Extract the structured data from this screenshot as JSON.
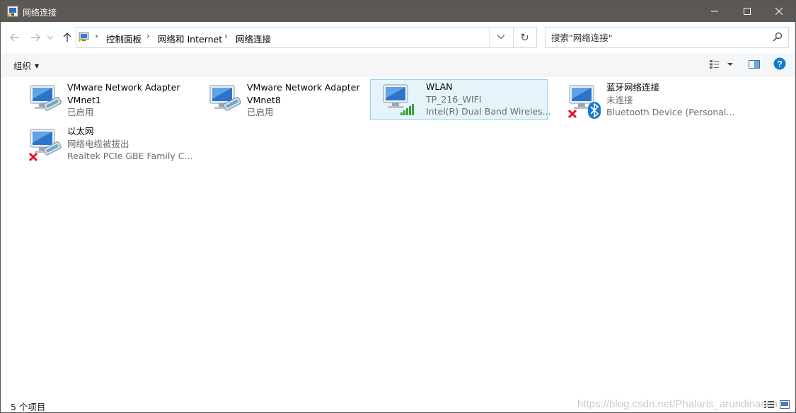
{
  "window": {
    "title": "网络连接",
    "icon": "network-connections-icon"
  },
  "addressbar": {
    "breadcrumbs": [
      "控制面板",
      "网络和 Internet",
      "网络连接"
    ],
    "refresh_glyph": "↻"
  },
  "search": {
    "placeholder": "搜索\"网络连接\""
  },
  "commandbar": {
    "organize_label": "组织"
  },
  "colors": {
    "titlebar": "#5d5854",
    "selection_bg": "#e5f3fb",
    "selection_border": "#99d1ef",
    "help_blue": "#1979ca",
    "error_red": "#e81123",
    "signal_green": "#3aa13a"
  },
  "items": [
    {
      "name": "VMware Network Adapter",
      "line2": "VMnet1",
      "line3": "已启用",
      "line2_style": "name",
      "icon": "network-adapter-icon",
      "status": "enabled"
    },
    {
      "name": "VMware Network Adapter",
      "line2": "VMnet8",
      "line3": "已启用",
      "line2_style": "name",
      "icon": "network-adapter-icon",
      "status": "enabled"
    },
    {
      "name": "WLAN",
      "line2": "TP_216_WIFI",
      "line3": "Intel(R) Dual Band Wireles...",
      "icon": "wifi-adapter-icon",
      "status": "connected",
      "selected": true
    },
    {
      "name": "蓝牙网络连接",
      "line2": "未连接",
      "line3": "Bluetooth Device (Personal...",
      "icon": "bluetooth-adapter-icon",
      "status": "disconnected"
    },
    {
      "name": "以太网",
      "line2": "网络电缆被拔出",
      "line3": "Realtek PCIe GBE Family C...",
      "icon": "ethernet-adapter-icon",
      "status": "cable-unplugged"
    }
  ],
  "statusbar": {
    "item_count": "5 个项目",
    "watermark": "https://blog.csdn.net/Phalaris_arundinacea"
  }
}
